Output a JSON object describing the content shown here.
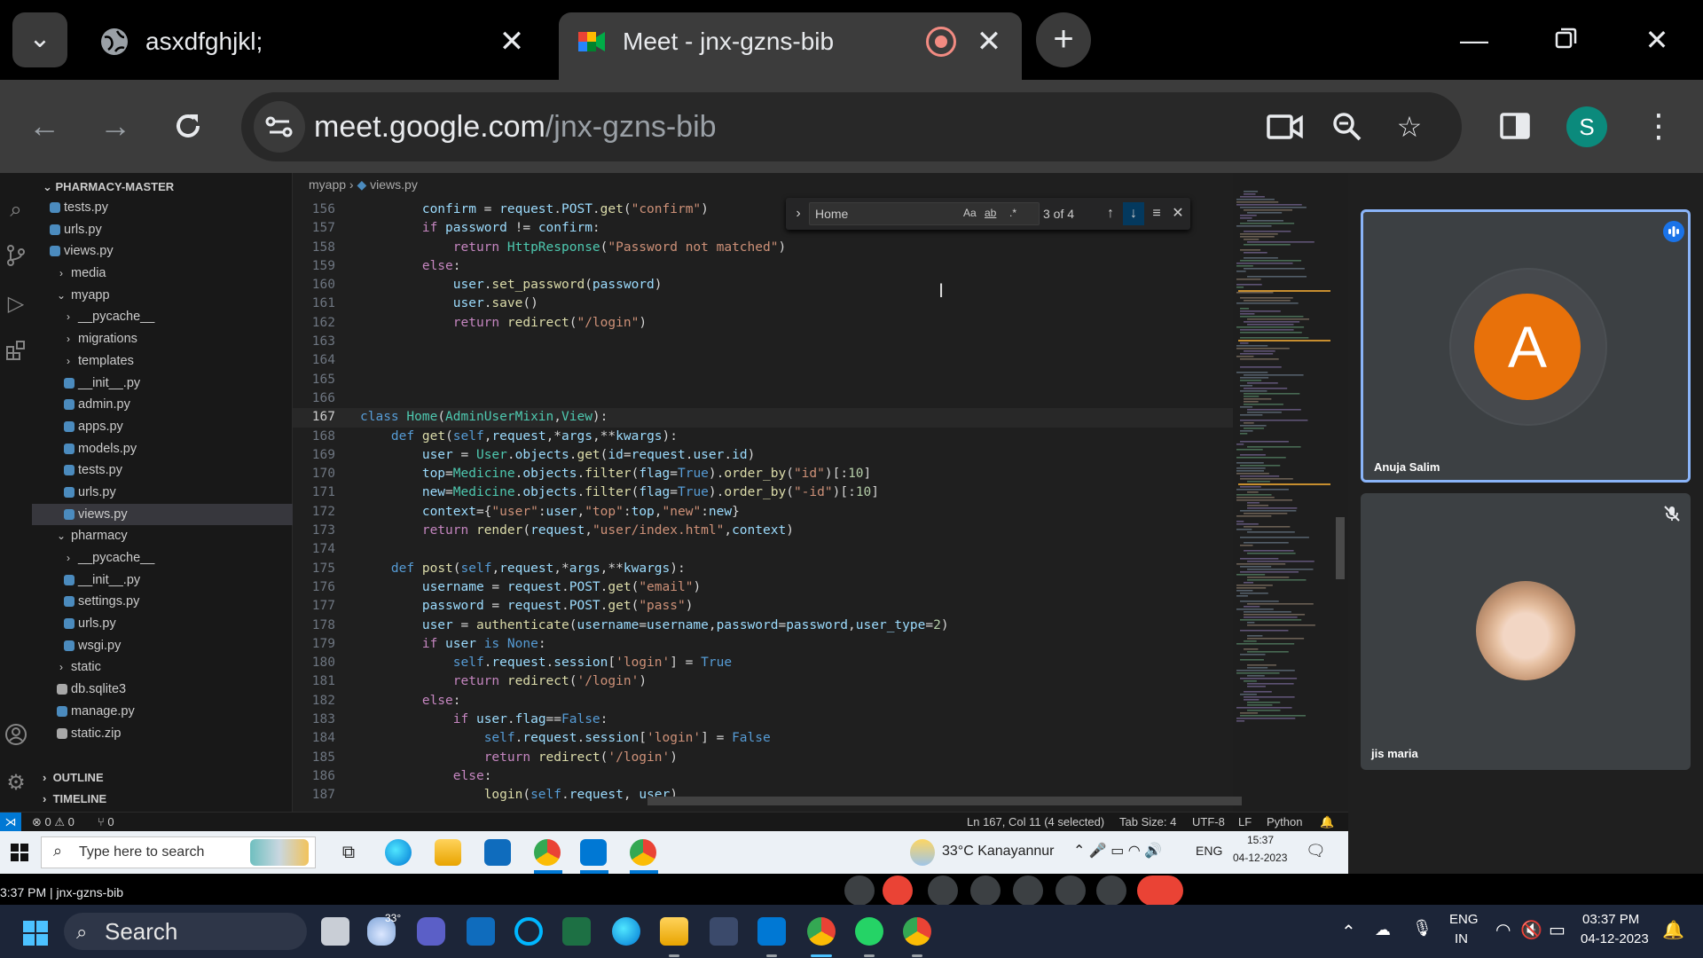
{
  "browser": {
    "tabs": [
      {
        "title": "asxdfghjkl;",
        "favicon": "globe-icon",
        "active": false
      },
      {
        "title": "Meet - jnx-gzns-bib",
        "favicon": "google-meet-icon",
        "active": true
      }
    ],
    "url": {
      "host": "meet.google.com",
      "path": "/jnx-gzns-bib"
    },
    "profile_initial": "S",
    "toolbar_icons": [
      "back-icon",
      "forward-icon",
      "reload-icon",
      "site-settings-icon",
      "camera-in-use-icon",
      "zoom-icon",
      "bookmark-star-icon",
      "side-panel-icon",
      "menu-icon"
    ]
  },
  "vscode": {
    "explorer": {
      "title": "PHARMACY-MASTER",
      "items": [
        {
          "label": "tests.py",
          "type": "py"
        },
        {
          "label": "urls.py",
          "type": "py"
        },
        {
          "label": "views.py",
          "type": "py"
        },
        {
          "label": "media",
          "type": "folder-closed"
        },
        {
          "label": "myapp",
          "type": "folder-open"
        },
        {
          "label": "__pycache__",
          "type": "folder-closed"
        },
        {
          "label": "migrations",
          "type": "folder-closed"
        },
        {
          "label": "templates",
          "type": "folder-closed"
        },
        {
          "label": "__init__.py",
          "type": "py"
        },
        {
          "label": "admin.py",
          "type": "py"
        },
        {
          "label": "apps.py",
          "type": "py"
        },
        {
          "label": "models.py",
          "type": "py"
        },
        {
          "label": "tests.py",
          "type": "py"
        },
        {
          "label": "urls.py",
          "type": "py"
        },
        {
          "label": "views.py",
          "type": "py",
          "selected": true
        },
        {
          "label": "pharmacy",
          "type": "folder-open"
        },
        {
          "label": "__pycache__",
          "type": "folder-closed"
        },
        {
          "label": "__init__.py",
          "type": "py"
        },
        {
          "label": "settings.py",
          "type": "py"
        },
        {
          "label": "urls.py",
          "type": "py"
        },
        {
          "label": "wsgi.py",
          "type": "py"
        },
        {
          "label": "static",
          "type": "folder-closed"
        },
        {
          "label": "db.sqlite3",
          "type": "db"
        },
        {
          "label": "manage.py",
          "type": "py"
        },
        {
          "label": "static.zip",
          "type": "zip"
        }
      ],
      "outline": "OUTLINE",
      "timeline": "TIMELINE"
    },
    "breadcrumb": [
      "myapp",
      "views.py"
    ],
    "find": {
      "query": "Home",
      "count": "3 of 4",
      "options": [
        "Aa",
        "ab",
        ".*"
      ]
    },
    "code": [
      {
        "n": "156",
        "t": "        confirm = request.POST.get(\"confirm\")"
      },
      {
        "n": "157",
        "t": "        if password != confirm:"
      },
      {
        "n": "158",
        "t": "            return HttpResponse(\"Password not matched\")"
      },
      {
        "n": "159",
        "t": "        else:"
      },
      {
        "n": "160",
        "t": "            user.set_password(password)"
      },
      {
        "n": "161",
        "t": "            user.save()"
      },
      {
        "n": "162",
        "t": "            return redirect(\"/login\")"
      },
      {
        "n": "163",
        "t": ""
      },
      {
        "n": "164",
        "t": ""
      },
      {
        "n": "165",
        "t": ""
      },
      {
        "n": "166",
        "t": ""
      },
      {
        "n": "167",
        "t": "class Home(AdminUserMixin,View):",
        "current": true
      },
      {
        "n": "168",
        "t": "    def get(self,request,*args,**kwargs):"
      },
      {
        "n": "169",
        "t": "        user = User.objects.get(id=request.user.id)"
      },
      {
        "n": "170",
        "t": "        top=Medicine.objects.filter(flag=True).order_by(\"id\")[:10]"
      },
      {
        "n": "171",
        "t": "        new=Medicine.objects.filter(flag=True).order_by(\"-id\")[:10]"
      },
      {
        "n": "172",
        "t": "        context={\"user\":user,\"top\":top,\"new\":new}"
      },
      {
        "n": "173",
        "t": "        return render(request,\"user/index.html\",context)"
      },
      {
        "n": "174",
        "t": ""
      },
      {
        "n": "175",
        "t": "    def post(self,request,*args,**kwargs):"
      },
      {
        "n": "176",
        "t": "        username = request.POST.get(\"email\")"
      },
      {
        "n": "177",
        "t": "        password = request.POST.get(\"pass\")"
      },
      {
        "n": "178",
        "t": "        user = authenticate(username=username,password=password,user_type=2)"
      },
      {
        "n": "179",
        "t": "        if user is None:"
      },
      {
        "n": "180",
        "t": "            self.request.session['login'] = True"
      },
      {
        "n": "181",
        "t": "            return redirect('/login')"
      },
      {
        "n": "182",
        "t": "        else:"
      },
      {
        "n": "183",
        "t": "            if user.flag==False:"
      },
      {
        "n": "184",
        "t": "                self.request.session['login'] = False"
      },
      {
        "n": "185",
        "t": "                return redirect('/login')"
      },
      {
        "n": "186",
        "t": "            else:"
      },
      {
        "n": "187",
        "t": "                login(self.request, user)"
      }
    ],
    "status": {
      "problems": "⊗ 0 ⚠ 0",
      "ports": "⑂ 0",
      "position": "Ln 167, Col 11 (4 selected)",
      "tab_size": "Tab Size: 4",
      "encoding": "UTF-8",
      "eol": "LF",
      "language": "Python"
    },
    "inner_taskbar": {
      "search_placeholder": "Type here to search",
      "weather": "33°C  Kanayannur",
      "lang": "ENG",
      "time": "15:37",
      "date": "04-12-2023"
    }
  },
  "meet": {
    "participants": [
      {
        "name": "Anuja Salim",
        "initial": "A",
        "speaking": true
      },
      {
        "name": "jis maria",
        "muted": true
      }
    ],
    "bottom_text": "3:37 PM  |  jnx-gzns-bib"
  },
  "taskbar": {
    "search_label": "Search",
    "weather_temp": "33°",
    "lang": "ENG",
    "region": "IN",
    "time": "03:37 PM",
    "date": "04-12-2023"
  },
  "colors": {
    "meet_accent": "#8ab4f8",
    "avatar_orange": "#e8710a",
    "vscode_accent": "#0078d4",
    "find_highlight": "#9e6a03"
  }
}
